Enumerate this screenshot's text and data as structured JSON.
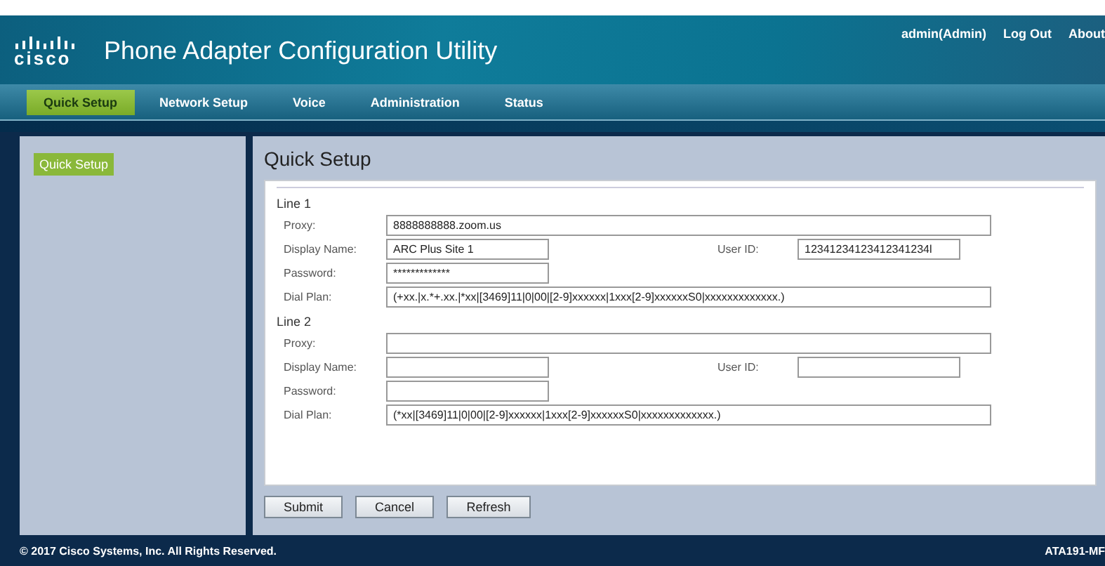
{
  "header": {
    "logo": "cisco",
    "title": "Phone Adapter Configuration Utility",
    "links": [
      "admin(Admin)",
      "Log Out",
      "About"
    ]
  },
  "nav": [
    {
      "label": "Quick Setup",
      "selected": true
    },
    {
      "label": "Network Setup",
      "selected": false
    },
    {
      "label": "Voice",
      "selected": false
    },
    {
      "label": "Administration",
      "selected": false
    },
    {
      "label": "Status",
      "selected": false
    }
  ],
  "sidebar": {
    "items": [
      {
        "label": "Quick Setup",
        "selected": true
      }
    ]
  },
  "page_title": "Quick Setup",
  "lines": [
    {
      "title": "Line 1",
      "proxy": {
        "label": "Proxy:",
        "value": "8888888888.zoom.us"
      },
      "display_name": {
        "label": "Display Name:",
        "value": "ARC Plus Site 1"
      },
      "user_id": {
        "label": "User ID:",
        "value": "12341234123412341234l"
      },
      "password": {
        "label": "Password:",
        "value": "*************"
      },
      "dial_plan": {
        "label": "Dial Plan:",
        "value": "(+xx.|x.*+.xx.|*xx|[3469]11|0|00|[2-9]xxxxxx|1xxx[2-9]xxxxxxS0|xxxxxxxxxxxxx.)"
      }
    },
    {
      "title": "Line 2",
      "proxy": {
        "label": "Proxy:"
      },
      "display_name": {
        "label": "Display Name:"
      },
      "user_id": {
        "label": "User ID:"
      },
      "password": {
        "label": "Password:"
      },
      "dial_plan": {
        "label": "Dial Plan:",
        "value": "(*xx|[3469]11|0|00|[2-9]xxxxxx|1xxx[2-9]xxxxxxS0|xxxxxxxxxxxxx.)"
      }
    }
  ],
  "buttons": [
    "Submit",
    "Cancel",
    "Refresh"
  ],
  "footer": {
    "copyright": "© 2017 Cisco Systems, Inc. All Rights Reserved.",
    "model": "ATA191-MF"
  }
}
